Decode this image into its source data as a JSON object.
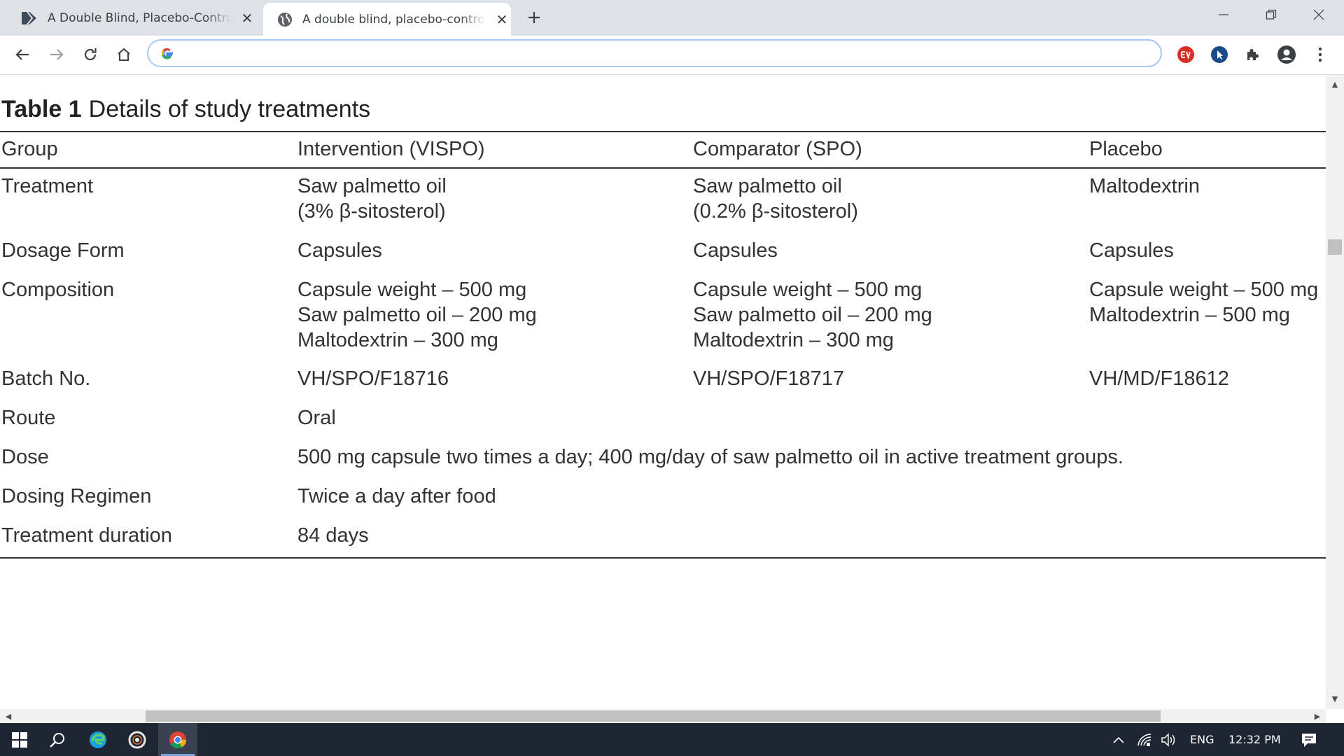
{
  "browser": {
    "tabs": [
      {
        "title": "A Double Blind, Placebo-Controlled",
        "icon": "document-arrow-icon",
        "active": false
      },
      {
        "title": "A double blind, placebo-controlled",
        "icon": "globe-icon",
        "active": true
      }
    ],
    "close_glyph": "✕",
    "omnibox": {
      "value": "",
      "placeholder": ""
    }
  },
  "table": {
    "label": "Table 1",
    "caption": "Details of study treatments",
    "headers": [
      "Group",
      "Intervention (VISPO)",
      "Comparator (SPO)",
      "Placebo"
    ],
    "rows": {
      "treatment": {
        "label": "Treatment",
        "vispo": [
          "Saw palmetto oil",
          "(3% β-sitosterol)"
        ],
        "spo": [
          "Saw palmetto oil",
          "(0.2% β-sitosterol)"
        ],
        "placebo": "Maltodextrin"
      },
      "dosage_form": {
        "label": "Dosage Form",
        "vispo": "Capsules",
        "spo": "Capsules",
        "placebo": "Capsules"
      },
      "composition": {
        "label": "Composition",
        "vispo": [
          "Capsule weight – 500 mg",
          "Saw palmetto oil – 200 mg",
          "Maltodextrin – 300 mg"
        ],
        "spo": [
          "Capsule weight – 500 mg",
          "Saw palmetto oil – 200 mg",
          "Maltodextrin – 300 mg"
        ],
        "placebo": [
          "Capsule weight – 500 mg",
          "Maltodextrin – 500 mg"
        ]
      },
      "batch": {
        "label": "Batch No.",
        "vispo": "VH/SPO/F18716",
        "spo": "VH/SPO/F18717",
        "placebo": "VH/MD/F18612"
      },
      "route": {
        "label": "Route",
        "value": "Oral"
      },
      "dose": {
        "label": "Dose",
        "value": "500 mg capsule two times a day; 400 mg/day of saw palmetto oil in active treatment groups."
      },
      "regimen": {
        "label": "Dosing Regimen",
        "value": "Twice a day after food"
      },
      "duration": {
        "label": "Treatment duration",
        "value": "84 days"
      }
    }
  },
  "taskbar": {
    "language": "ENG",
    "time": "12:32 PM"
  },
  "colors": {
    "tabstrip": "#dee1e6",
    "omnibox_border": "#a8c7fa",
    "taskbar": "#1f2633",
    "extension_red": "#d93025",
    "extension_blue": "#1a4c8b"
  }
}
